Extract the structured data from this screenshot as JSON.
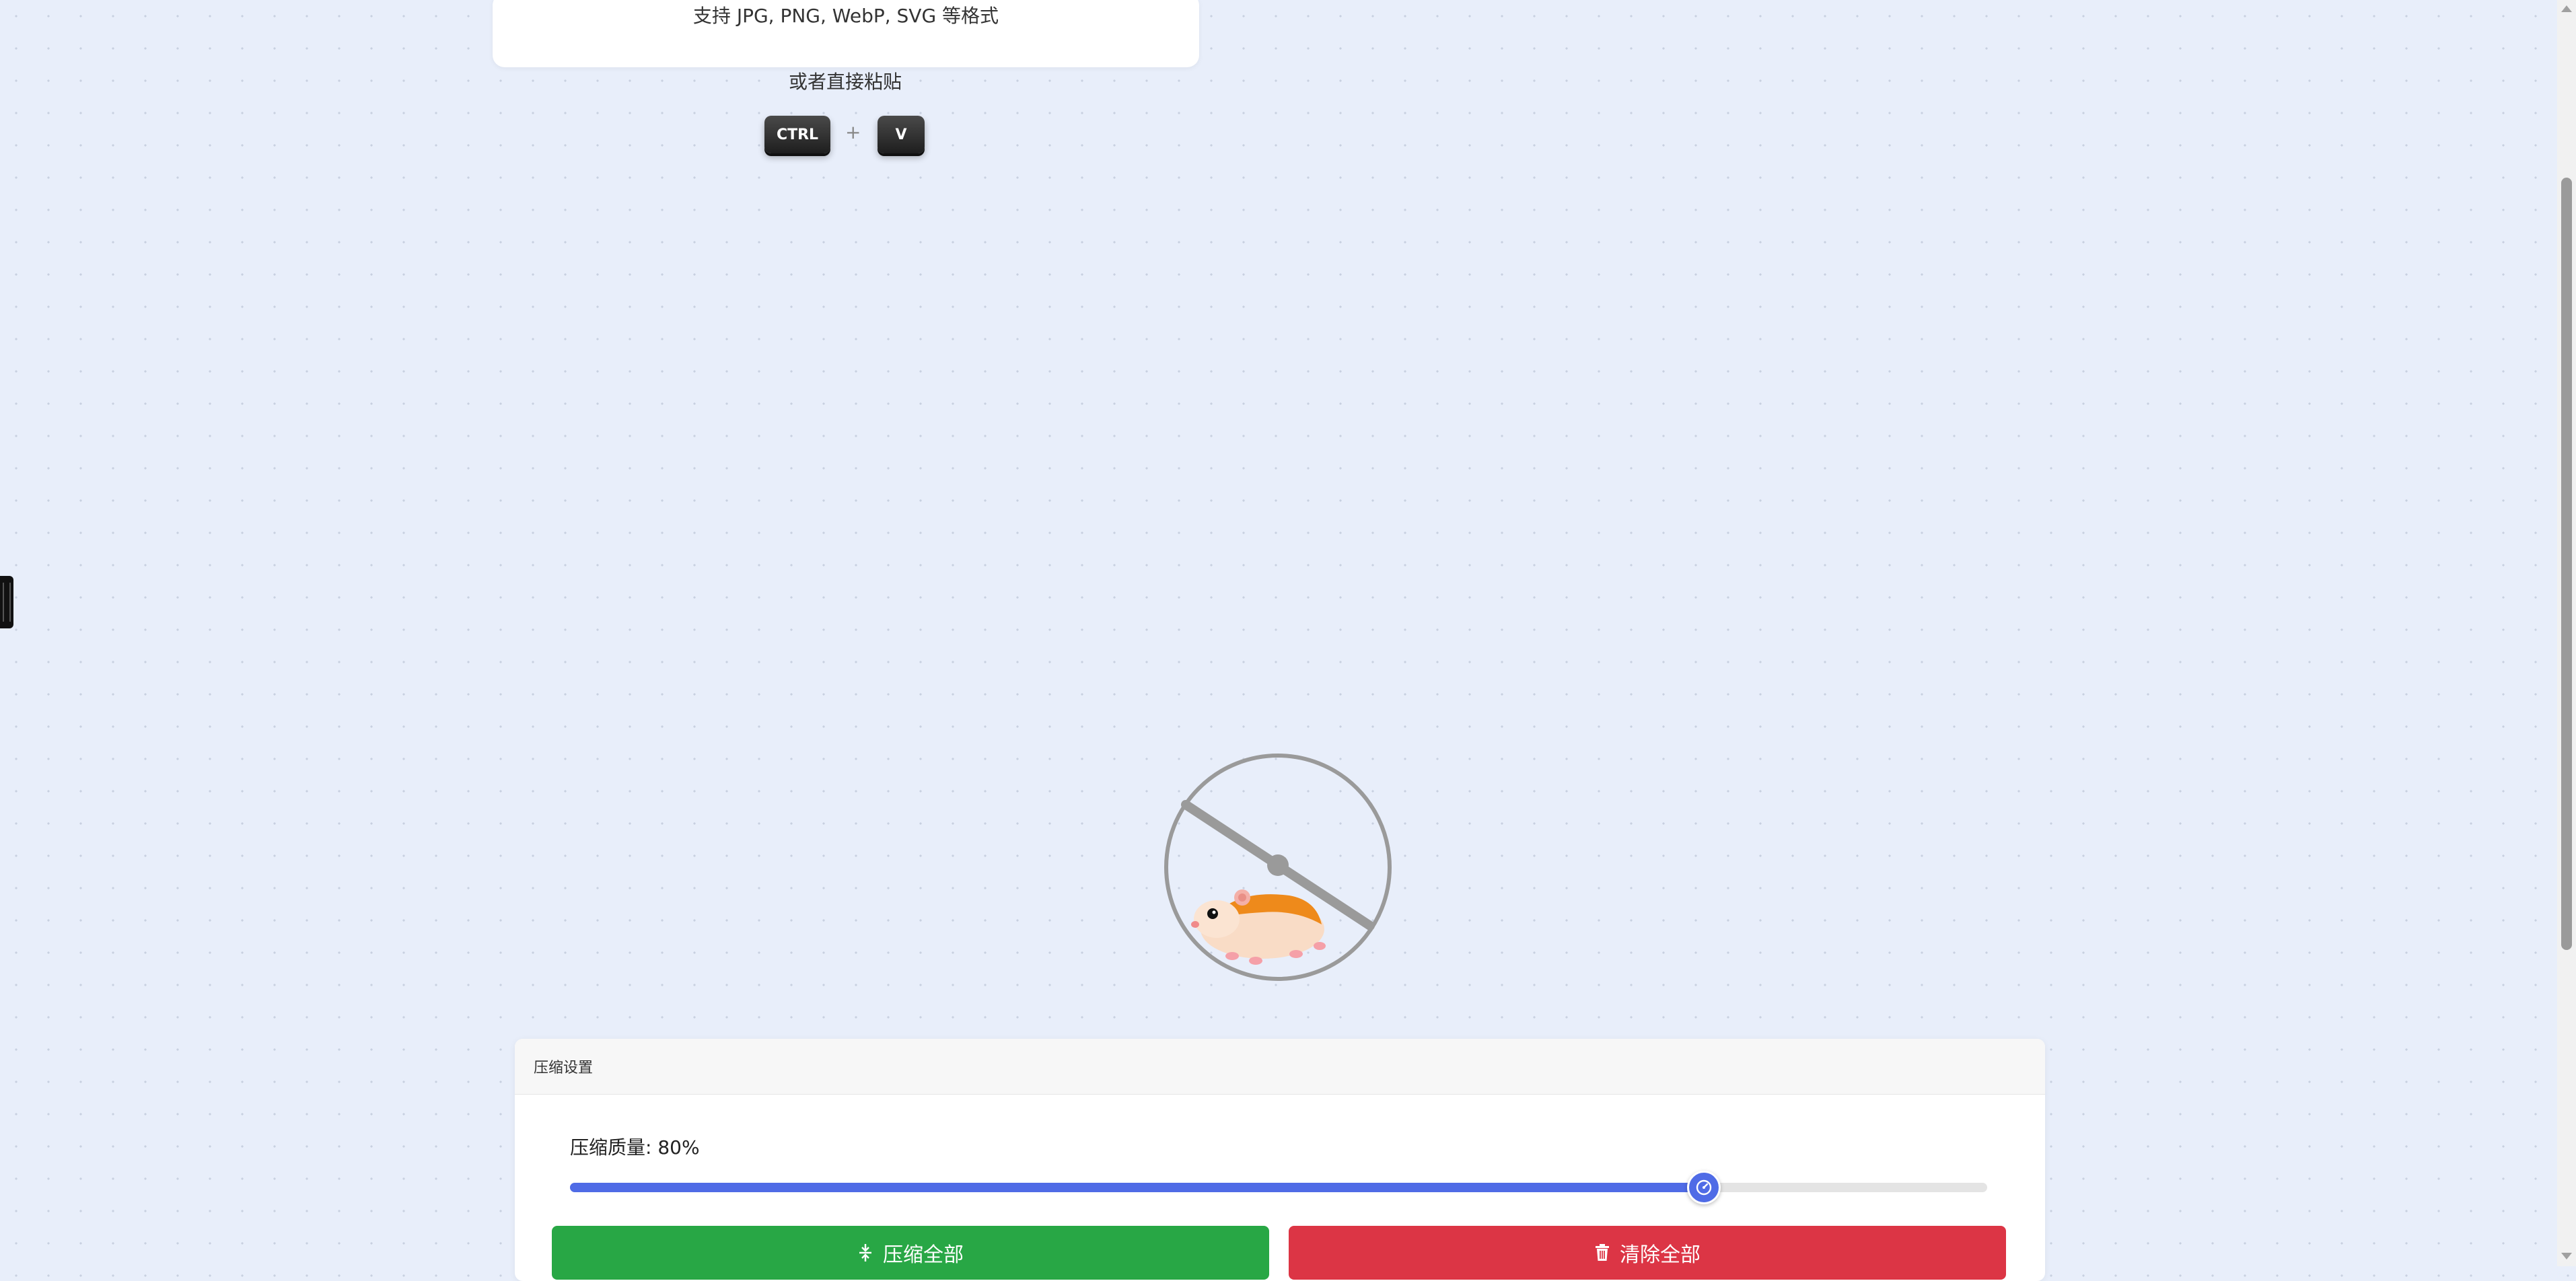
{
  "upload": {
    "formats_text": "支持 JPG, PNG, WebP, SVG 等格式",
    "paste_hint": "或者直接粘贴",
    "key_ctrl": "CTRL",
    "key_plus": "+",
    "key_v": "V"
  },
  "settings": {
    "header": "压缩设置",
    "quality_label": "压缩质量: 80%",
    "quality_value": 80,
    "compress_all_label": "压缩全部",
    "clear_all_label": "清除全部"
  },
  "colors": {
    "accent": "#4f6be6",
    "success": "#28a745",
    "danger": "#dc3545"
  },
  "icons": {
    "compress": "compress-icon",
    "clear": "trash-icon",
    "slider_thumb": "gauge-icon",
    "loading": "hamster-wheel-icon"
  }
}
